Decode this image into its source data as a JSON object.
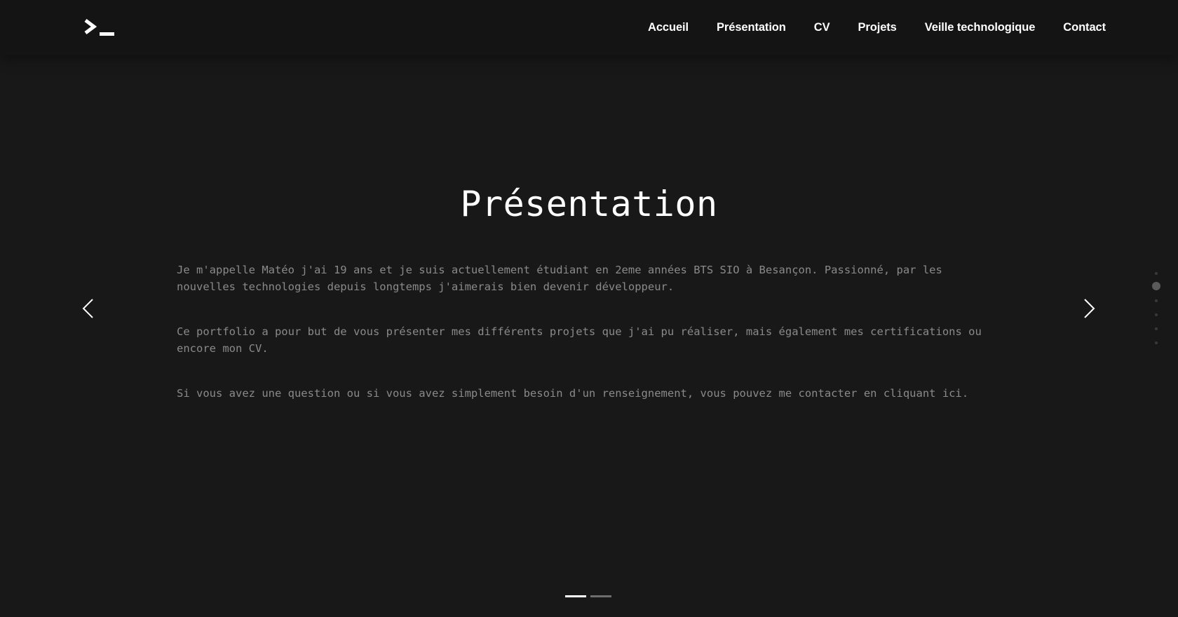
{
  "header": {
    "logo_icon": "terminal-prompt-icon",
    "nav_items": [
      {
        "label": "Accueil"
      },
      {
        "label": "Présentation"
      },
      {
        "label": "CV"
      },
      {
        "label": "Projets"
      },
      {
        "label": "Veille technologique"
      },
      {
        "label": "Contact"
      }
    ]
  },
  "main": {
    "title": "Présentation",
    "paragraphs": [
      "Je m'appelle Matéo j'ai 19 ans et je suis actuellement étudiant en 2eme années BTS SIO à Besançon. Passionné, par les nouvelles technologies depuis longtemps j'aimerais bien devenir développeur.",
      "Ce portfolio a pour but de vous présenter mes différents projets que j'ai pu réaliser, mais également mes certifications ou encore mon CV.",
      "Si vous avez une question ou si vous avez simplement besoin d'un renseignement, vous pouvez me contacter en cliquant ici."
    ]
  },
  "carousel": {
    "prev_icon": "chevron-left-icon",
    "next_icon": "chevron-right-icon",
    "slide_count": 2,
    "active_slide": 1
  },
  "section_nav": {
    "dot_count": 6,
    "active_index": 1
  },
  "colors": {
    "background": "#181818",
    "header_background": "#141414",
    "text": "#ffffff",
    "body_text": "#8a8a8a"
  }
}
